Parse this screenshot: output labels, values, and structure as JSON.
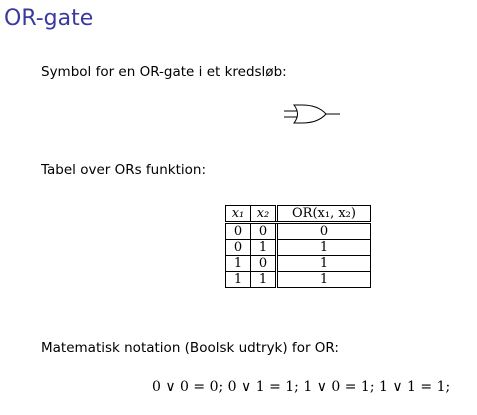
{
  "title": "OR-gate",
  "symbol_text": "Symbol for en OR-gate i et kredsløb:",
  "table_intro": "Tabel over ORs funktion:",
  "truth_table": {
    "headers": [
      "x₁",
      "x₂",
      "OR(x₁, x₂)"
    ],
    "rows": [
      [
        "0",
        "0",
        "0"
      ],
      [
        "0",
        "1",
        "1"
      ],
      [
        "1",
        "0",
        "1"
      ],
      [
        "1",
        "1",
        "1"
      ]
    ]
  },
  "notation_text": "Matematisk notation (Boolsk udtryk) for OR:",
  "formula": "0 ∨ 0 = 0;  0 ∨ 1 = 1;  1 ∨ 0 = 1;  1 ∨ 1 = 1;",
  "colors": {
    "title": "#3a3a9e"
  },
  "icons": [
    "or-gate-icon"
  ]
}
